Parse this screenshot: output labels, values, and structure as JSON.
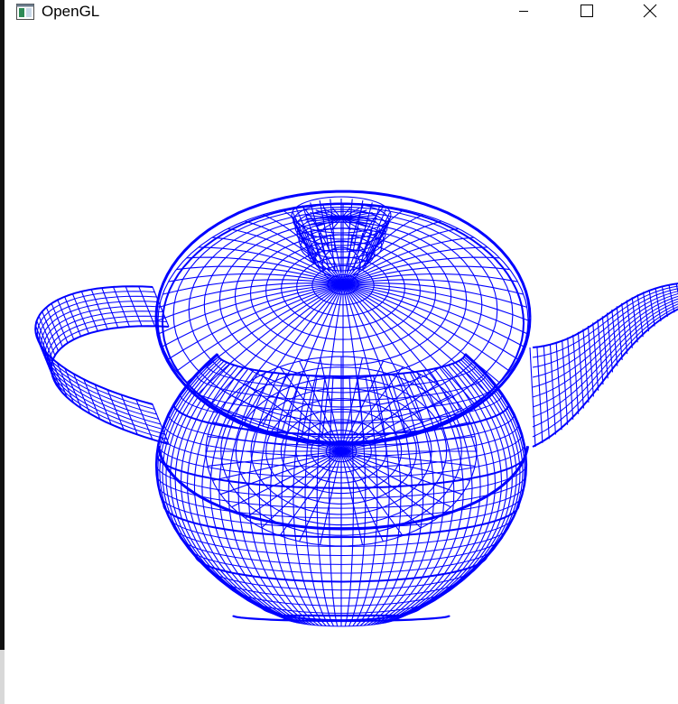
{
  "window": {
    "title": "OpenGL",
    "controls": {
      "minimize": "minimize-icon",
      "maximize": "maximize-icon",
      "close": "close-icon"
    }
  },
  "viewport": {
    "background": "#ffffff",
    "render": {
      "object": "teapot",
      "mode": "wireframe",
      "line_color": "#0000ff"
    }
  }
}
